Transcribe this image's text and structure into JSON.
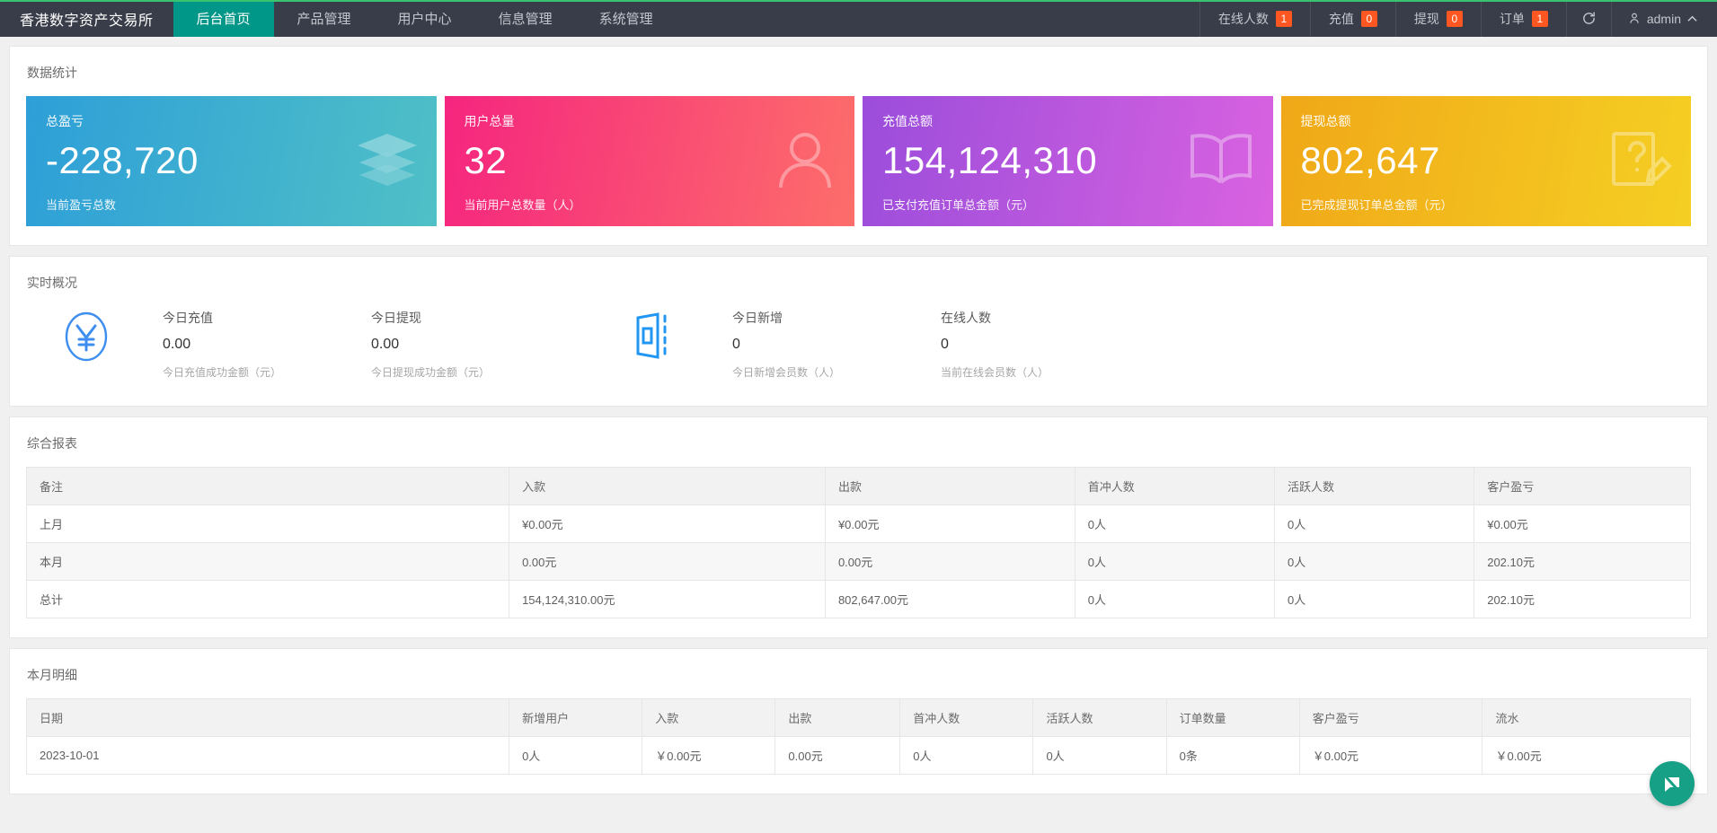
{
  "header": {
    "brand": "香港数字资产交易所",
    "nav": [
      {
        "label": "后台首页",
        "active": true
      },
      {
        "label": "产品管理",
        "active": false
      },
      {
        "label": "用户中心",
        "active": false
      },
      {
        "label": "信息管理",
        "active": false
      },
      {
        "label": "系统管理",
        "active": false
      }
    ],
    "right": [
      {
        "label": "在线人数",
        "badge": "1"
      },
      {
        "label": "充值",
        "badge": "0"
      },
      {
        "label": "提现",
        "badge": "0"
      },
      {
        "label": "订单",
        "badge": "1"
      }
    ],
    "refresh_icon": "refresh-icon",
    "user_icon": "user-icon",
    "user_name": "admin",
    "accent_green": "#39C36E",
    "active_nav_color": "#009688",
    "badge_color": "#FF5722"
  },
  "stats": {
    "title": "数据统计",
    "cards": [
      {
        "label": "总盈亏",
        "value": "-228,720",
        "sub": "当前盈亏总数",
        "icon": "layers-icon",
        "color": "#2e9fd8"
      },
      {
        "label": "用户总量",
        "value": "32",
        "sub": "当前用户总数量（人）",
        "icon": "user-outline-icon",
        "color": "#f5257f"
      },
      {
        "label": "充值总额",
        "value": "154,124,310",
        "sub": "已支付充值订单总金额（元）",
        "icon": "book-icon",
        "color": "#9b4ddb"
      },
      {
        "label": "提现总额",
        "value": "802,647",
        "sub": "已完成提现订单总金额（元）",
        "icon": "edit-note-icon",
        "color": "#f0a818"
      }
    ]
  },
  "realtime": {
    "title": "实时概况",
    "icon_left": "yen-circle-icon",
    "icon_mid": "door-icon",
    "items": [
      {
        "name": "今日充值",
        "value": "0.00",
        "desc": "今日充值成功金额（元）"
      },
      {
        "name": "今日提现",
        "value": "0.00",
        "desc": "今日提现成功金额（元）"
      },
      {
        "name": "今日新增",
        "value": "0",
        "desc": "今日新增会员数（人）"
      },
      {
        "name": "在线人数",
        "value": "0",
        "desc": "当前在线会员数（人）"
      }
    ]
  },
  "report": {
    "title": "综合报表",
    "columns": [
      "备注",
      "入款",
      "出款",
      "首冲人数",
      "活跃人数",
      "客户盈亏"
    ],
    "rows": [
      [
        "上月",
        "¥0.00元",
        "¥0.00元",
        "0人",
        "0人",
        "¥0.00元"
      ],
      [
        "本月",
        "0.00元",
        "0.00元",
        "0人",
        "0人",
        "202.10元"
      ],
      [
        "总计",
        "154,124,310.00元",
        "802,647.00元",
        "0人",
        "0人",
        "202.10元"
      ]
    ]
  },
  "detail": {
    "title": "本月明细",
    "columns": [
      "日期",
      "新增用户",
      "入款",
      "出款",
      "首冲人数",
      "活跃人数",
      "订单数量",
      "客户盈亏",
      "流水"
    ],
    "rows": [
      [
        "2023-10-01",
        "0人",
        "￥0.00元",
        "0.00元",
        "0人",
        "0人",
        "0条",
        "￥0.00元",
        "￥0.00元"
      ]
    ]
  },
  "float_button": {
    "icon": "feedback-icon",
    "color": "#16a085"
  }
}
